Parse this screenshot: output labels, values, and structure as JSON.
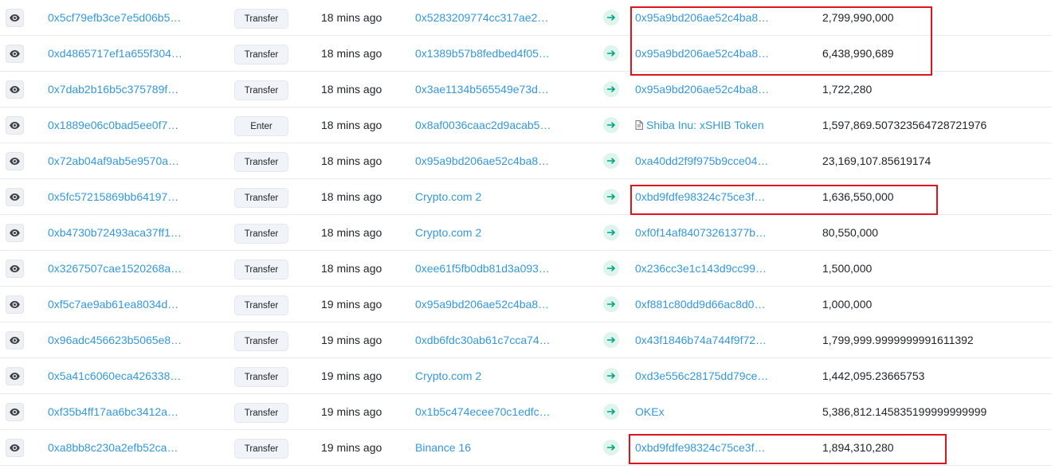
{
  "transfers": {
    "rows": [
      {
        "hash": "0x5cf79efb3ce7e5d06b5…",
        "method": "Transfer",
        "age": "18 mins ago",
        "from": "0x5283209774cc317ae2…",
        "to": "0x95a9bd206ae52c4ba8…",
        "to_is_contract": false,
        "quantity": "2,799,990,000"
      },
      {
        "hash": "0xd4865717ef1a655f304…",
        "method": "Transfer",
        "age": "18 mins ago",
        "from": "0x1389b57b8fedbed4f05…",
        "to": "0x95a9bd206ae52c4ba8…",
        "to_is_contract": false,
        "quantity": "6,438,990,689"
      },
      {
        "hash": "0x7dab2b16b5c375789f…",
        "method": "Transfer",
        "age": "18 mins ago",
        "from": "0x3ae1134b565549e73d…",
        "to": "0x95a9bd206ae52c4ba8…",
        "to_is_contract": false,
        "quantity": "1,722,280"
      },
      {
        "hash": "0x1889e06c0bad5ee0f7…",
        "method": "Enter",
        "age": "18 mins ago",
        "from": "0x8af0036caac2d9acab5…",
        "to": "Shiba Inu: xSHIB Token",
        "to_is_contract": true,
        "quantity": "1,597,869.507323564728721976"
      },
      {
        "hash": "0x72ab04af9ab5e9570a…",
        "method": "Transfer",
        "age": "18 mins ago",
        "from": "0x95a9bd206ae52c4ba8…",
        "to": "0xa40dd2f9f975b9cce04…",
        "to_is_contract": false,
        "quantity": "23,169,107.85619174"
      },
      {
        "hash": "0x5fc57215869bb64197…",
        "method": "Transfer",
        "age": "18 mins ago",
        "from": "Crypto.com 2",
        "to": "0xbd9fdfe98324c75ce3f…",
        "to_is_contract": false,
        "quantity": "1,636,550,000"
      },
      {
        "hash": "0xb4730b72493aca37ff1…",
        "method": "Transfer",
        "age": "18 mins ago",
        "from": "Crypto.com 2",
        "to": "0xf0f14af84073261377b…",
        "to_is_contract": false,
        "quantity": "80,550,000"
      },
      {
        "hash": "0x3267507cae1520268a…",
        "method": "Transfer",
        "age": "18 mins ago",
        "from": "0xee61f5fb0db81d3a093…",
        "to": "0x236cc3e1c143d9cc99…",
        "to_is_contract": false,
        "quantity": "1,500,000"
      },
      {
        "hash": "0xf5c7ae9ab61ea8034d…",
        "method": "Transfer",
        "age": "19 mins ago",
        "from": "0x95a9bd206ae52c4ba8…",
        "to": "0xf881c80dd9d66ac8d0…",
        "to_is_contract": false,
        "quantity": "1,000,000"
      },
      {
        "hash": "0x96adc456623b5065e8…",
        "method": "Transfer",
        "age": "19 mins ago",
        "from": "0xdb6fdc30ab61c7cca74…",
        "to": "0x43f1846b74a744f9f72…",
        "to_is_contract": false,
        "quantity": "1,799,999.9999999991611392"
      },
      {
        "hash": "0x5a41c6060eca426338…",
        "method": "Transfer",
        "age": "19 mins ago",
        "from": "Crypto.com 2",
        "to": "0xd3e556c28175dd79ce…",
        "to_is_contract": false,
        "quantity": "1,442,095.23665753"
      },
      {
        "hash": "0xf35b4ff17aa6bc3412a…",
        "method": "Transfer",
        "age": "19 mins ago",
        "from": "0x1b5c474ecee70c1edfc…",
        "to": "OKEx",
        "to_is_contract": false,
        "quantity": "5,386,812.145835199999999999"
      },
      {
        "hash": "0xa8bb8c230a2efb52ca…",
        "method": "Transfer",
        "age": "19 mins ago",
        "from": "Binance 16",
        "to": "0xbd9fdfe98324c75ce3f…",
        "to_is_contract": false,
        "quantity": "1,894,310,280"
      }
    ]
  },
  "icons": {
    "view": "eye-icon",
    "direction": "arrow-right-icon",
    "contract": "document-icon"
  },
  "colors": {
    "link": "#3498db",
    "highlight": "#e0141d",
    "arrow": "#00a186",
    "arrow_bg": "#def5ec"
  }
}
